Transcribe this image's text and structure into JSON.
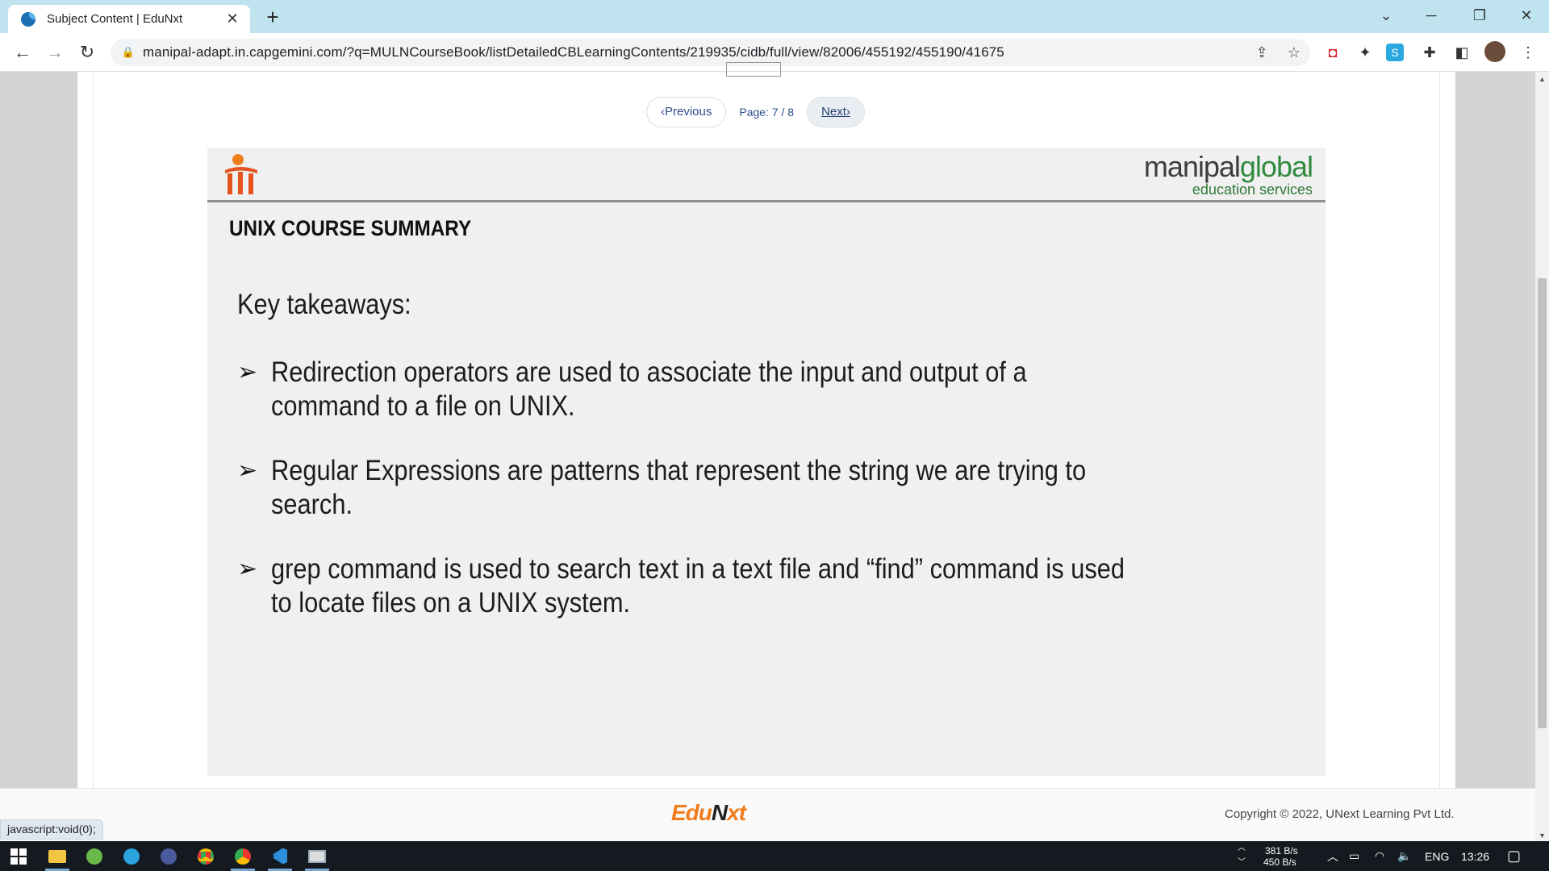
{
  "browser": {
    "tab_title": "Subject Content | EduNxt",
    "new_tab": "+",
    "url": "manipal-adapt.in.capgemini.com/?q=MULNCourseBook/listDetailedCBLearningContents/219935/cidb/full/view/82006/455192/455190/41675"
  },
  "pager": {
    "previous_label": "Previous",
    "page_text": "Page: 7 / 8",
    "next_label": "Next"
  },
  "slide": {
    "brand_main_1": "manipal",
    "brand_main_2": "global",
    "brand_sub": "education services",
    "title": "UNIX COURSE SUMMARY",
    "subtitle": "Key takeaways:",
    "bullets": [
      "Redirection operators are used to associate the input and output of a command to a file on UNIX.",
      "Regular Expressions are patterns that represent the string we are trying to search.",
      "grep command is used to search text in a text file and “find” command is used to locate files on a UNIX system."
    ]
  },
  "footer": {
    "logo_1": "Edu",
    "logo_2": "N",
    "logo_3": "xt",
    "copyright": "Copyright © 2022, UNext Learning Pvt Ltd."
  },
  "status_bar": "javascript:void(0);",
  "taskbar": {
    "net_up": "381 B/s",
    "net_down": "450 B/s",
    "language": "ENG",
    "time": "13:26"
  },
  "colors": {
    "tab_strip": "#bfe4ef",
    "brand_green": "#2f8a3f",
    "edunxt_orange": "#f07d1c",
    "link_blue": "#2a4e8a"
  }
}
